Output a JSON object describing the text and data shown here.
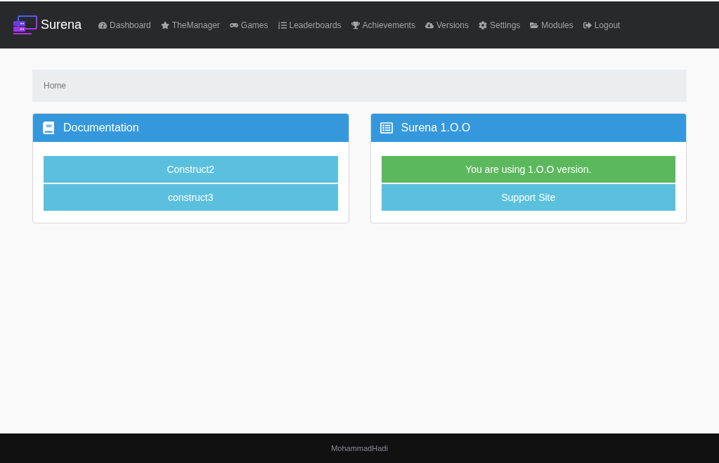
{
  "brand": {
    "name": "Surena"
  },
  "nav": [
    {
      "label": "Dashboard"
    },
    {
      "label": "TheManager"
    },
    {
      "label": "Games"
    },
    {
      "label": "Leaderboards"
    },
    {
      "label": "Achievements"
    },
    {
      "label": "Versions"
    },
    {
      "label": "Settings"
    },
    {
      "label": "Modules"
    },
    {
      "label": "Logout"
    }
  ],
  "breadcrumb": [
    "Home"
  ],
  "panels": [
    {
      "title": "Documentation",
      "buttons": [
        {
          "label": "Construct2",
          "kind": "info"
        },
        {
          "label": "construct3",
          "kind": "info"
        }
      ]
    },
    {
      "title": "Surena 1.O.O",
      "buttons": [
        {
          "label": "You are using 1.O.O version.",
          "kind": "success"
        },
        {
          "label": "Support Site",
          "kind": "info"
        }
      ]
    }
  ],
  "footer": {
    "text": "MohammadHadi"
  }
}
